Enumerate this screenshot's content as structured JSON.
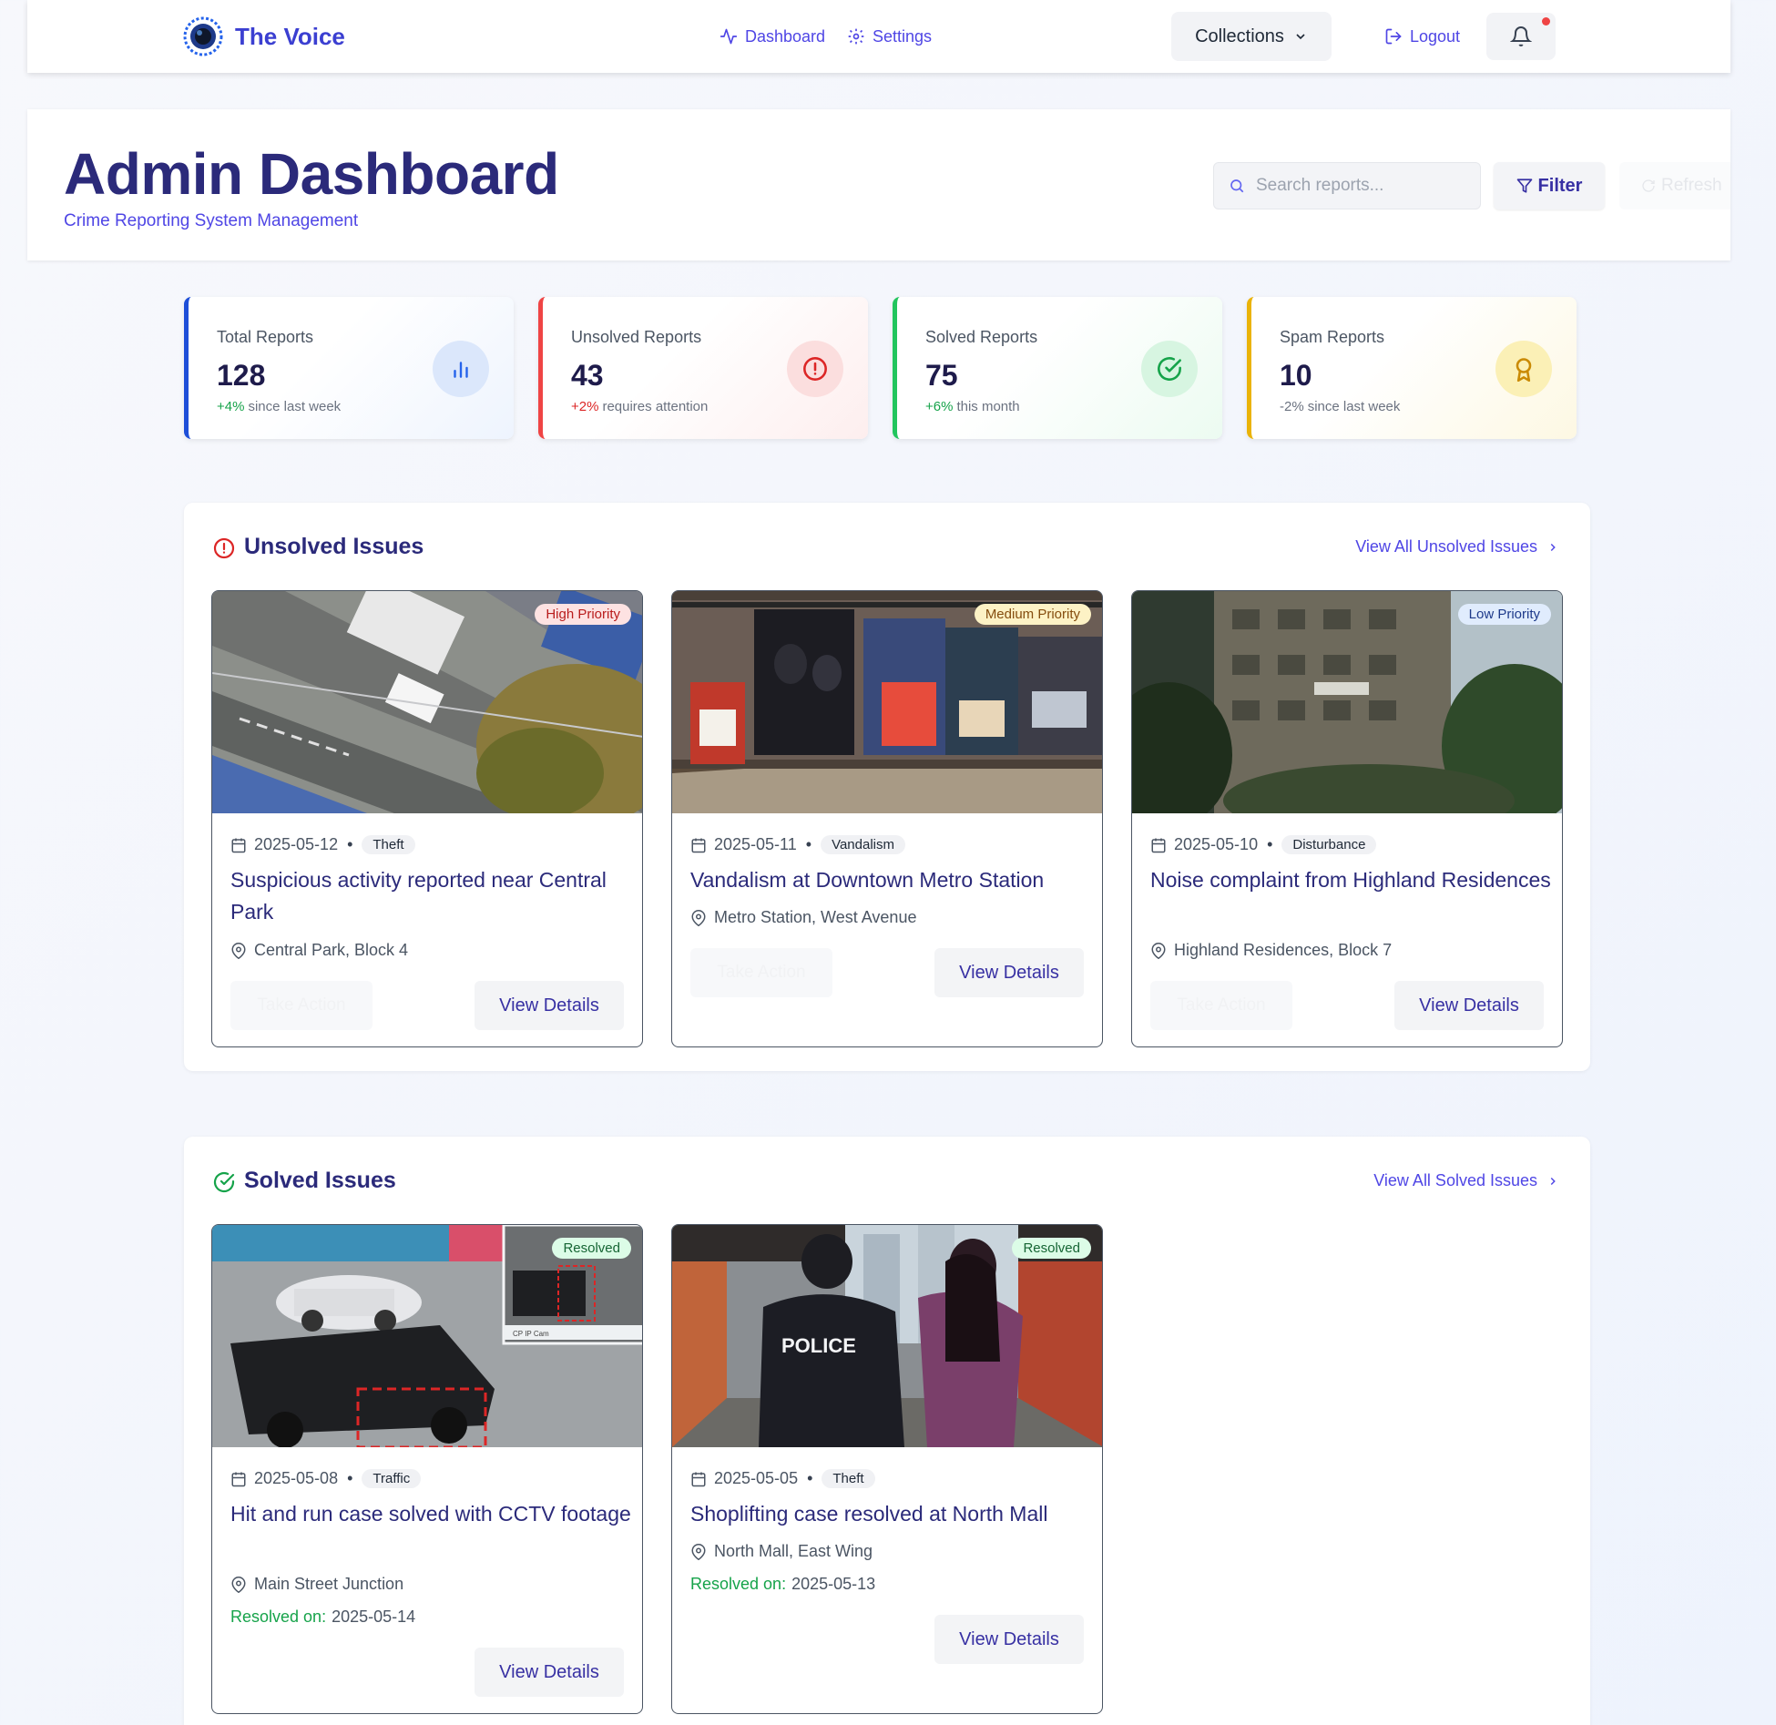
{
  "nav": {
    "brand": "The Voice",
    "dashboard": "Dashboard",
    "settings": "Settings",
    "collections": "Collections",
    "logout": "Logout"
  },
  "header": {
    "title": "Admin Dashboard",
    "subtitle": "Crime Reporting System Management",
    "search_placeholder": "Search reports...",
    "filter": "Filter",
    "refresh": "Refresh"
  },
  "stats": [
    {
      "label": "Total Reports",
      "value": "128",
      "delta": "+4%",
      "note": "since last week",
      "color": "#1d4ed8"
    },
    {
      "label": "Unsolved Reports",
      "value": "43",
      "delta": "+2%",
      "note": "requires attention",
      "color": "#ef4444"
    },
    {
      "label": "Solved Reports",
      "value": "75",
      "delta": "+6%",
      "note": "this month",
      "color": "#22c55e"
    },
    {
      "label": "Spam Reports",
      "value": "10",
      "delta": "-2%",
      "note": "since last week",
      "color": "#eab308"
    }
  ],
  "unsolved": {
    "title": "Unsolved Issues",
    "link": "View All Unsolved Issues",
    "items": [
      {
        "priority": "High Priority",
        "date": "2025-05-12",
        "category": "Theft",
        "title": "Suspicious activity reported near Central Park",
        "location": "Central Park, Block 4",
        "action": "Take Action",
        "view": "View Details"
      },
      {
        "priority": "Medium Priority",
        "date": "2025-05-11",
        "category": "Vandalism",
        "title": "Vandalism at Downtown Metro Station",
        "location": "Metro Station, West Avenue",
        "action": "Take Action",
        "view": "View Details"
      },
      {
        "priority": "Low Priority",
        "date": "2025-05-10",
        "category": "Disturbance",
        "title": "Noise complaint from Highland Residences",
        "location": "Highland Residences, Block 7",
        "action": "Take Action",
        "view": "View Details"
      }
    ]
  },
  "solved": {
    "title": "Solved Issues",
    "link": "View All Solved Issues",
    "items": [
      {
        "status": "Resolved",
        "date": "2025-05-08",
        "category": "Traffic",
        "title": "Hit and run case solved with CCTV footage",
        "location": "Main Street Junction",
        "resolved_label": "Resolved on:",
        "resolved_date": "2025-05-14",
        "view": "View Details",
        "cctv_caption": "CP IP Cam"
      },
      {
        "status": "Resolved",
        "date": "2025-05-05",
        "category": "Theft",
        "title": "Shoplifting case resolved at North Mall",
        "location": "North Mall, East Wing",
        "resolved_label": "Resolved on:",
        "resolved_date": "2025-05-13",
        "view": "View Details",
        "vest_text": "POLICE"
      }
    ]
  }
}
